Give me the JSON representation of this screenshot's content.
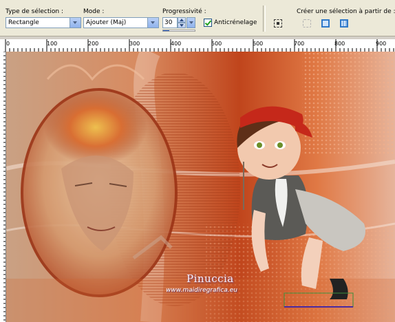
{
  "toolbar": {
    "selection_type": {
      "label": "Type de sélection :",
      "value": "Rectangle"
    },
    "mode": {
      "label": "Mode :",
      "value": "Ajouter (Maj)"
    },
    "feather": {
      "label": "Progressivité :",
      "value": "30"
    },
    "antialias": {
      "label": "Anticrénelage",
      "checked": true
    },
    "create_from": {
      "label": "Créer une sélection à partir de :"
    },
    "icons": [
      "select-none-icon",
      "from-layer-icon",
      "from-image-icon",
      "from-mask-icon"
    ]
  },
  "ruler": {
    "ticks": [
      "0",
      "100",
      "200",
      "300",
      "400",
      "500",
      "600",
      "700",
      "800",
      "900"
    ]
  },
  "canvas": {
    "watermark_title": "Pinuccia",
    "watermark_url": "www.maidiregrafica.eu"
  },
  "colors": {
    "toolbar_bg": "#ece9d8",
    "accent": "#2f63c6",
    "image_orange": "#d6652e"
  }
}
